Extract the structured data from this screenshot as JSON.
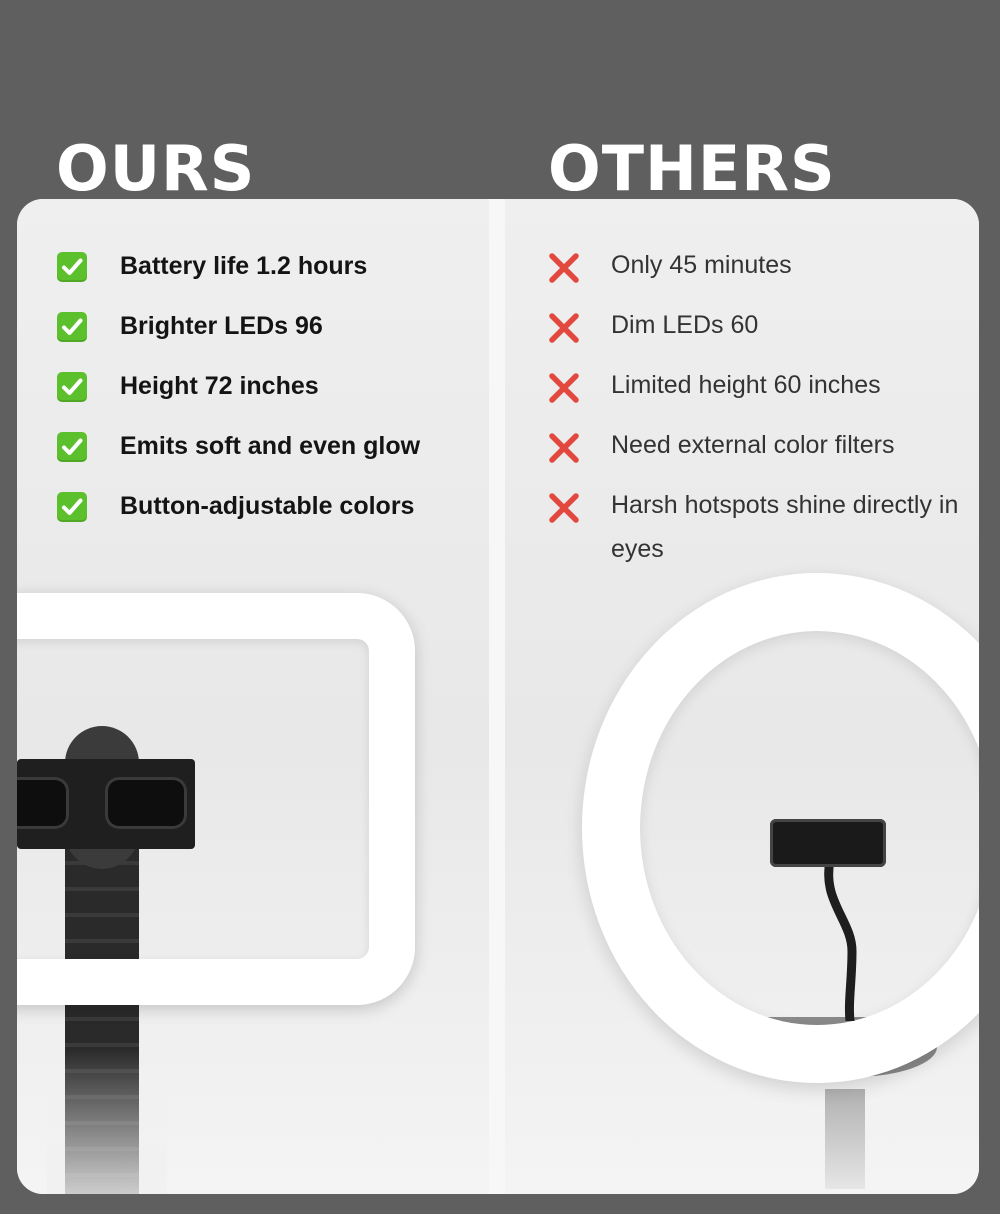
{
  "ours": {
    "heading": "OURS",
    "items": [
      "Battery life 1.2 hours",
      "Brighter LEDs 96",
      "Height 72 inches",
      "Emits soft and even glow",
      "Button-adjustable colors"
    ]
  },
  "others": {
    "heading": "OTHERS",
    "items": [
      "Only 45 minutes",
      "Dim LEDs 60",
      "Limited height 60 inches",
      "Need external color filters",
      "Harsh hotspots shine directly in eyes"
    ]
  },
  "colors": {
    "background": "#5f5f5f",
    "card": "#f1f1f1",
    "check": "#5cc02c",
    "cross": "#e2483d"
  },
  "icons": {
    "ours_marker": "check-mark-icon",
    "others_marker": "cross-mark-icon"
  }
}
